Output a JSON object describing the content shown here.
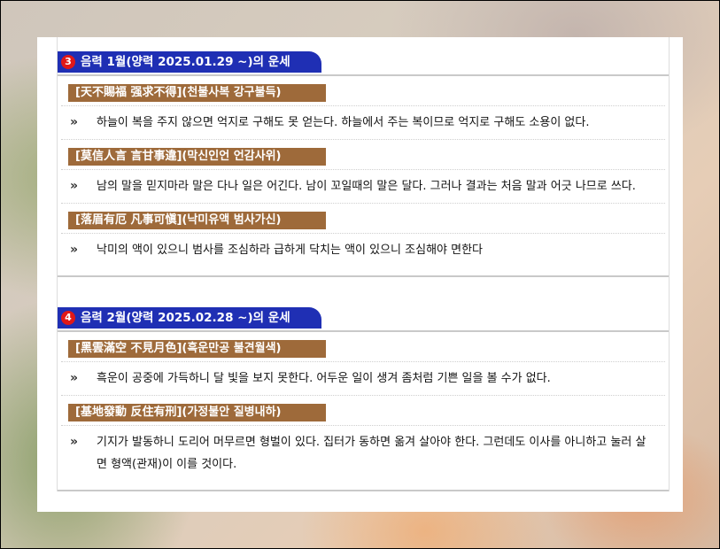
{
  "sections": [
    {
      "num": "3",
      "title": "음력 1월(양력 2025.01.29 ~)의 운세",
      "items": [
        {
          "title": "[天不賜福 强求不得](천불사복 강구불득)",
          "text": "하늘이 복을 주지 않으면 억지로 구해도 못 얻는다. 하늘에서 주는 복이므로 억지로 구해도 소용이 없다."
        },
        {
          "title": "[莫信人言 言甘事違](막신인언 언감사위)",
          "text": "남의 말을 믿지마라 말은 다나 일은 어긴다. 남이 꼬일때의 말은 달다. 그러나 결과는 처음 말과 어긋 나므로 쓰다."
        },
        {
          "title": "[落眉有厄 凡事可愼](낙미유액 범사가신)",
          "text": "낙미의 액이 있으니 범사를 조심하라 급하게 닥치는 액이 있으니 조심해야 면한다"
        }
      ]
    },
    {
      "num": "4",
      "title": "음력 2월(양력 2025.02.28 ~)의 운세",
      "items": [
        {
          "title": "[黑雲滿空 不見月色](흑운만공 불견월색)",
          "text": "흑운이 공중에 가득하니 달 빛을 보지 못한다. 어두운 일이 생겨 좀처럼 기쁜 일을 볼 수가 없다."
        },
        {
          "title": "[基地發動 反住有刑](가정불안 질병내하)",
          "text": "기지가 발동하니 도리어 머무르면 형벌이 있다. 집터가 동하면 옮겨 살아야 한다. 그런데도 이사를 아니하고 눌러 살면 형액(관재)이 이를 것이다."
        }
      ]
    }
  ],
  "bullet": "»"
}
